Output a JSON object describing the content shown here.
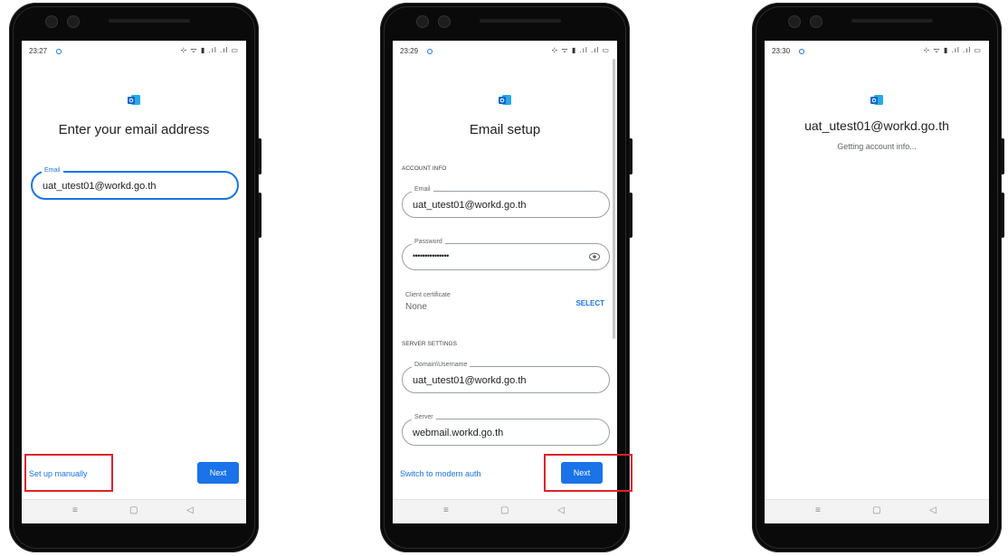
{
  "screens": [
    {
      "status_time": "23:27",
      "status_icons": "⊹ ᯤ ▮ .ıl .ıl ▭",
      "title": "Enter your email address",
      "email_label": "Email",
      "email_value": "uat_utest01@workd.go.th",
      "setup_manually": "Set up manually",
      "next": "Next"
    },
    {
      "status_time": "23:29",
      "status_icons": "⊹ ᯤ ▮ .ıl .ıl ▭",
      "title": "Email setup",
      "account_info": "ACCOUNT INFO",
      "email_label": "Email",
      "email_value": "uat_utest01@workd.go.th",
      "password_label": "Password",
      "password_value": "•••••••••••••••",
      "cert_label": "Client certificate",
      "cert_value": "None",
      "select": "SELECT",
      "server_settings": "SERVER SETTINGS",
      "domain_label": "Domain\\Username",
      "domain_value": "uat_utest01@workd.go.th",
      "server_label": "Server",
      "server_value": "webmail.workd.go.th",
      "switch_auth": "Switch to modern auth",
      "next": "Next"
    },
    {
      "status_time": "23:30",
      "status_icons": "⊹ ᯤ ▮ .ıl .ıl ▭",
      "account": "uat_utest01@workd.go.th",
      "progress_text": "Getting account info..."
    }
  ],
  "nav": {
    "menu": "≡",
    "home": "▢",
    "back": "◁"
  },
  "colors": {
    "accent": "#1a73e8",
    "highlight": "#e0212b",
    "outlook": "#0a64c8"
  },
  "icons": {
    "outlook": "outlook-logo-icon",
    "eye": "eye-icon"
  }
}
